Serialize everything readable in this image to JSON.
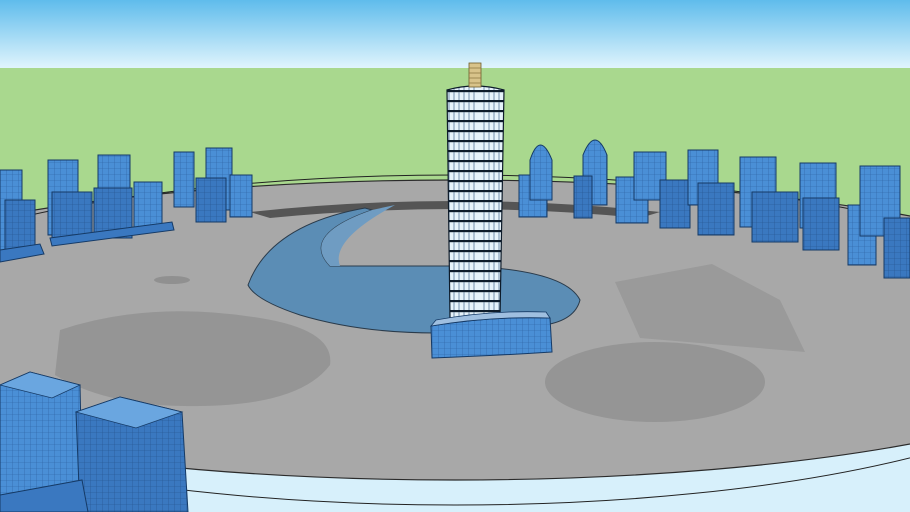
{
  "scene": {
    "colors": {
      "sky_top": "#5fbcec",
      "sky_bottom": "#e4f6fd",
      "grass": "#a9d88e",
      "ground": "#a9a9a9",
      "ground_edge": "#2b2b2b",
      "building": "#4a8fd6",
      "building_dark": "#2f6db3",
      "water": "#5b8db5",
      "shadow": "#8f8f8f",
      "tower_glass": "#dfeff9",
      "tower_band": "#0d1b2a",
      "spire": "#d8c38a"
    },
    "icons": [
      "skyscraper-icon",
      "building-icon"
    ]
  }
}
